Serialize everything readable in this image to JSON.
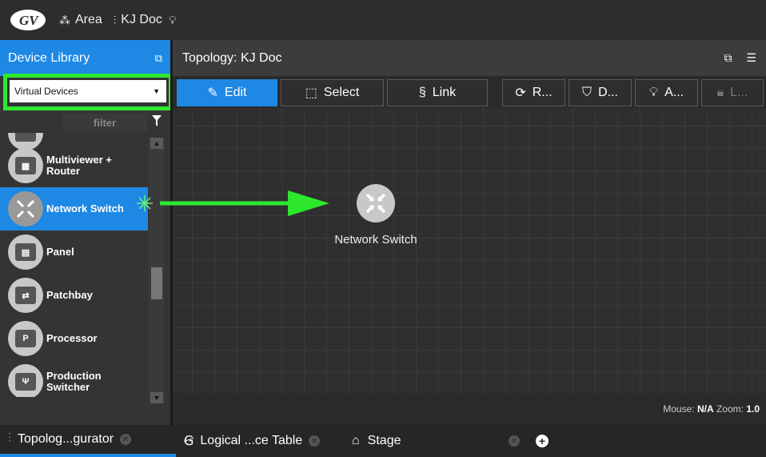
{
  "topbar": {
    "area": "Area",
    "doc": "KJ Doc"
  },
  "library": {
    "title": "Device Library",
    "dropdown_value": "Virtual Devices",
    "filter_placeholder": "filter",
    "items": [
      {
        "label": "Multiviewer +\nRouter",
        "icon": "multiviewer-router-icon"
      },
      {
        "label": "Network Switch",
        "icon": "network-switch-icon"
      },
      {
        "label": "Panel",
        "icon": "panel-icon"
      },
      {
        "label": "Patchbay",
        "icon": "patchbay-icon"
      },
      {
        "label": "Processor",
        "icon": "processor-icon"
      },
      {
        "label": "Production\nSwitcher",
        "icon": "production-switcher-icon"
      }
    ]
  },
  "topology": {
    "title": "Topology: KJ Doc",
    "toolbar": {
      "edit": "Edit",
      "select": "Select",
      "link": "Link",
      "r": "R...",
      "d": "D...",
      "a": "A...",
      "l": "L..."
    },
    "node_label": "Network Switch",
    "status": {
      "mouse_label": "Mouse:",
      "mouse_value": "N/A",
      "zoom_label": "Zoom:",
      "zoom_value": "1.0"
    }
  },
  "tabs": [
    {
      "label": "Topolog...gurator"
    },
    {
      "label": "Logical ...ce Table"
    },
    {
      "label": "Stage"
    }
  ],
  "colors": {
    "accent": "#1e88e5",
    "highlight": "#2ee82e"
  }
}
